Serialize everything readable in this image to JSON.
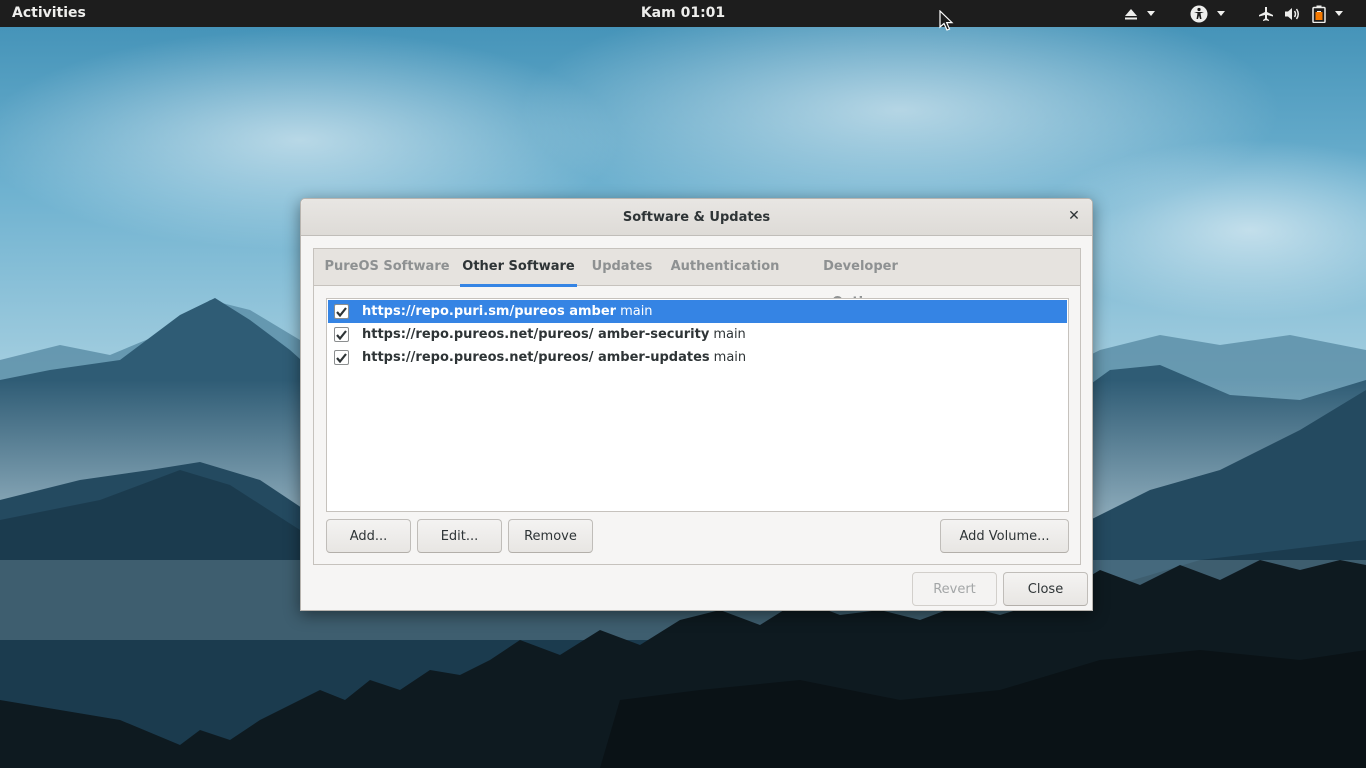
{
  "topbar": {
    "activities": "Activities",
    "clock": "Kam 01:01",
    "icons": [
      "eject-icon",
      "accessibility-icon",
      "airplane-mode-icon",
      "volume-icon",
      "battery-icon"
    ]
  },
  "dialog": {
    "title": "Software & Updates",
    "close_glyph": "✕",
    "tabs": [
      {
        "label": "PureOS Software",
        "active": false
      },
      {
        "label": "Other Software",
        "active": true
      },
      {
        "label": "Updates",
        "active": false
      },
      {
        "label": "Authentication",
        "active": false
      },
      {
        "label": "Developer Options",
        "active": false
      }
    ],
    "sources": [
      {
        "url": "https://repo.puri.sm/pureos amber",
        "component": "main",
        "checked": true,
        "selected": true
      },
      {
        "url": "https://repo.pureos.net/pureos/ amber-security",
        "component": "main",
        "checked": true,
        "selected": false
      },
      {
        "url": "https://repo.pureos.net/pureos/ amber-updates",
        "component": "main",
        "checked": true,
        "selected": false
      }
    ],
    "buttons": {
      "add": "Add...",
      "edit": "Edit...",
      "remove": "Remove",
      "add_volume": "Add Volume...",
      "revert": "Revert",
      "close": "Close"
    }
  },
  "colors": {
    "accent": "#3584e4",
    "topbar": "#1d1d1d"
  }
}
